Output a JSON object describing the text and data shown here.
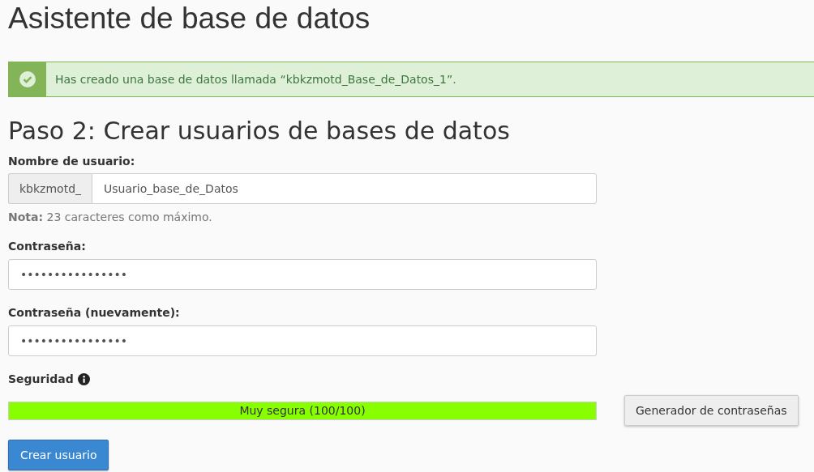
{
  "title": "Asistente de base de datos",
  "alert": {
    "kind": "success",
    "text": "Has creado una base de datos llamada “kbkzmotd_Base_de_Datos_1”."
  },
  "heading": "Paso 2: Crear usuarios de bases de datos",
  "username": {
    "label": "Nombre de usuario:",
    "prefix": "kbkzmotd_",
    "value": "Usuario_base_de_Datos",
    "note_label": "Nota:",
    "note": "23 caracteres como máximo."
  },
  "password": {
    "label": "Contraseña:",
    "value": "••••••••••••••••"
  },
  "password_again": {
    "label": "Contraseña (nuevamente):",
    "value": "••••••••••••••••"
  },
  "security": {
    "label": "Seguridad",
    "level": 1,
    "reading": "Muy segura (100/100)"
  },
  "generator_button": "Generador de contraseñas",
  "submit_button": "Crear usuario"
}
